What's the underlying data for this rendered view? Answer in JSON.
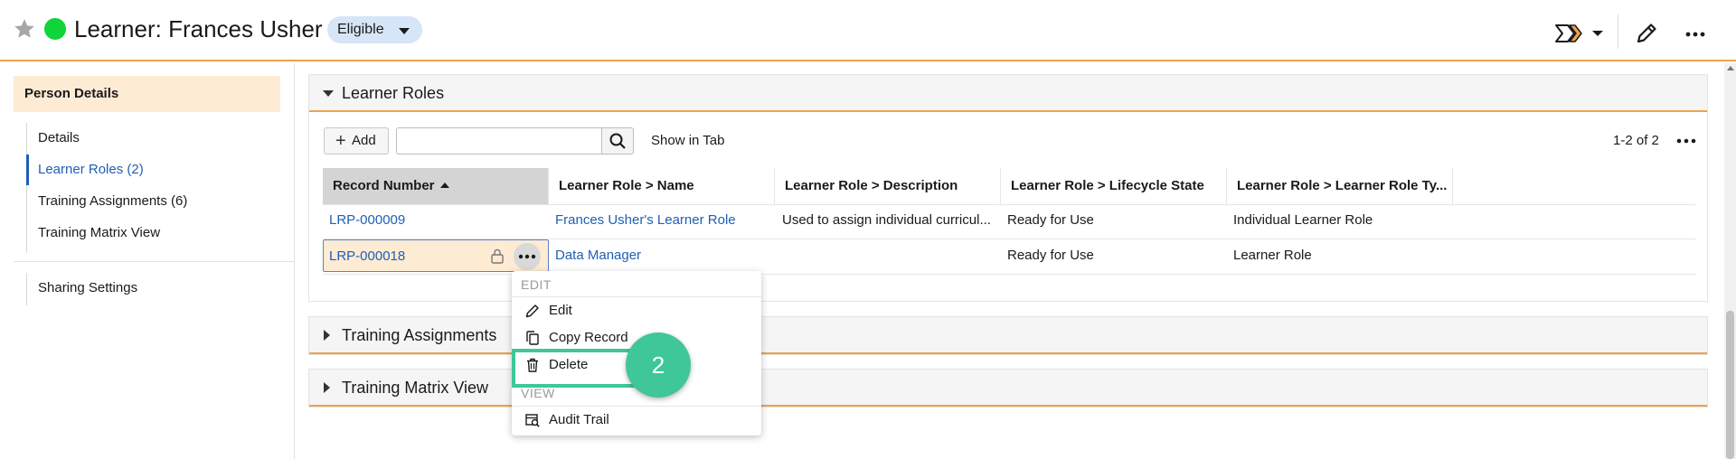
{
  "header": {
    "title": "Learner: Frances Usher",
    "status_badge": "Eligible",
    "status_color": "#0fd43a",
    "accent_color": "#f0a24c"
  },
  "sidebar": {
    "header": "Person Details",
    "items": [
      {
        "label": "Details",
        "active": false
      },
      {
        "label": "Learner Roles (2)",
        "active": true
      },
      {
        "label": "Training Assignments (6)",
        "active": false
      },
      {
        "label": "Training Matrix View",
        "active": false
      }
    ],
    "secondary_items": [
      {
        "label": "Sharing Settings"
      }
    ]
  },
  "sections": {
    "learner_roles": {
      "title": "Learner Roles",
      "add_label": "Add",
      "search_value": "",
      "show_in_tab_label": "Show in Tab",
      "pager": "1-2 of 2",
      "columns": [
        "Record Number",
        "Learner Role > Name",
        "Learner Role > Description",
        "Learner Role > Lifecycle State",
        "Learner Role > Learner Role Ty..."
      ],
      "rows": [
        {
          "record_number": "LRP-000009",
          "name": "Frances Usher's Learner Role",
          "description": "Used to assign individual curricul...",
          "lifecycle_state": "Ready for Use",
          "role_type": "Individual Learner Role"
        },
        {
          "record_number": "LRP-000018",
          "name": "Data Manager",
          "description": "",
          "lifecycle_state": "Ready for Use",
          "role_type": "Learner Role"
        }
      ]
    },
    "training_assignments": {
      "title": "Training Assignments"
    },
    "training_matrix_view": {
      "title": "Training Matrix View"
    }
  },
  "context_menu": {
    "edit_group": "EDIT",
    "view_group": "VIEW",
    "items": {
      "edit": "Edit",
      "copy_record": "Copy Record",
      "delete": "Delete",
      "audit_trail": "Audit Trail"
    }
  },
  "step_badge": "2",
  "icons": [
    "star-icon",
    "workflow-icon",
    "pencil-icon",
    "more-icon",
    "search-icon",
    "lock-icon",
    "trash-icon",
    "copy-icon",
    "audit-trail-icon"
  ]
}
